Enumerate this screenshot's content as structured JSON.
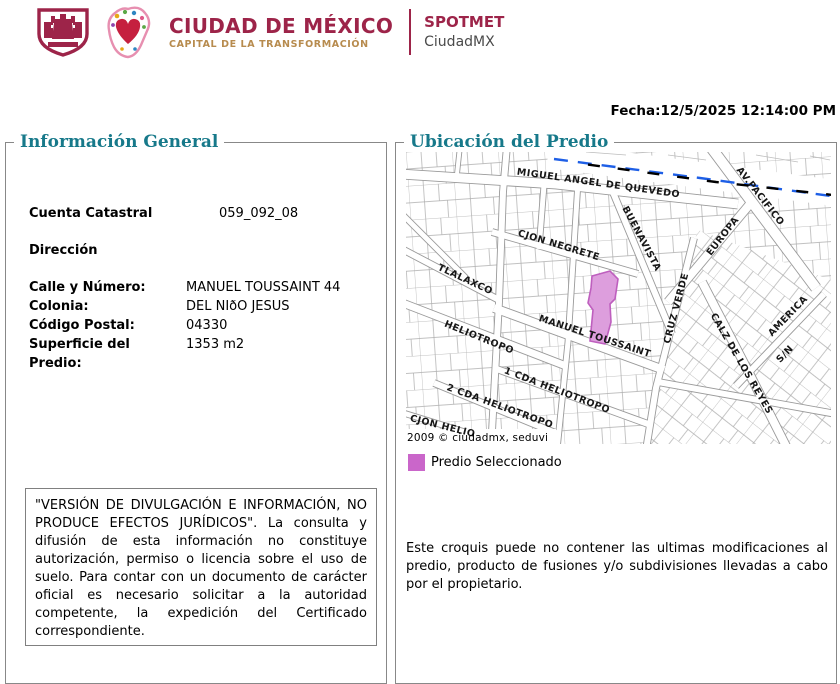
{
  "header": {
    "brand_title": "CIUDAD DE MÉXICO",
    "brand_subtitle": "CAPITAL DE LA TRANSFORMACIÓN",
    "app_title": "SPOTMET",
    "app_subtitle": "CiudadMX"
  },
  "fecha": "Fecha:12/5/2025 12:14:00 PM",
  "info": {
    "title": "Información General",
    "cuenta_label": "Cuenta Catastral",
    "cuenta_value": "059_092_08",
    "direccion_label": "Dirección",
    "rows": [
      {
        "label": "Calle y Número:",
        "value": "MANUEL TOUSSAINT 44"
      },
      {
        "label": "Colonia:",
        "value": "DEL NIðO JESUS"
      },
      {
        "label": "Código Postal:",
        "value": "04330"
      },
      {
        "label": "Superficie del Predio:",
        "value": "1353 m2"
      }
    ],
    "disclaimer": "\"VERSIÓN DE DIVULGACIÓN E INFORMACIÓN, NO PRODUCE EFECTOS JURÍDICOS\". La consulta y difusión de esta información no constituye autorización, permiso o licencia sobre el uso de suelo. Para contar con un documento de carácter oficial es necesario solicitar a la autoridad competente, la expedición del Certificado correspondiente."
  },
  "ubicacion": {
    "title": "Ubicación del Predio",
    "attribution": "2009 © ciudadmx, seduvi",
    "legend_label": "Predio Seleccionado",
    "legend_color": "#CA66CA",
    "parcel_fill": "#DD9EDD",
    "dashed_blue": "#1E5FE6",
    "dashed_black": "#000000",
    "note": "Este croquis puede no contener las ultimas modificaciones al predio, producto de fusiones y/o subdivisiones llevadas a cabo por el propietario.",
    "street_labels": [
      "MIGUEL ANGEL DE QUEVEDO",
      "AV.PACIFICO",
      "CJON NEGRETE",
      "BUENAVISTA",
      "EUROPA",
      "TLALAXCO",
      "MANUEL TOUSSAINT",
      "CRUZ VERDE",
      "CALZ DE LOS REYES",
      "AMERICA",
      "S/N",
      "HELIOTROPO",
      "1 CDA HELIOTROPO",
      "2 CDA HELIOTROPO",
      "CJON HELIO"
    ]
  }
}
